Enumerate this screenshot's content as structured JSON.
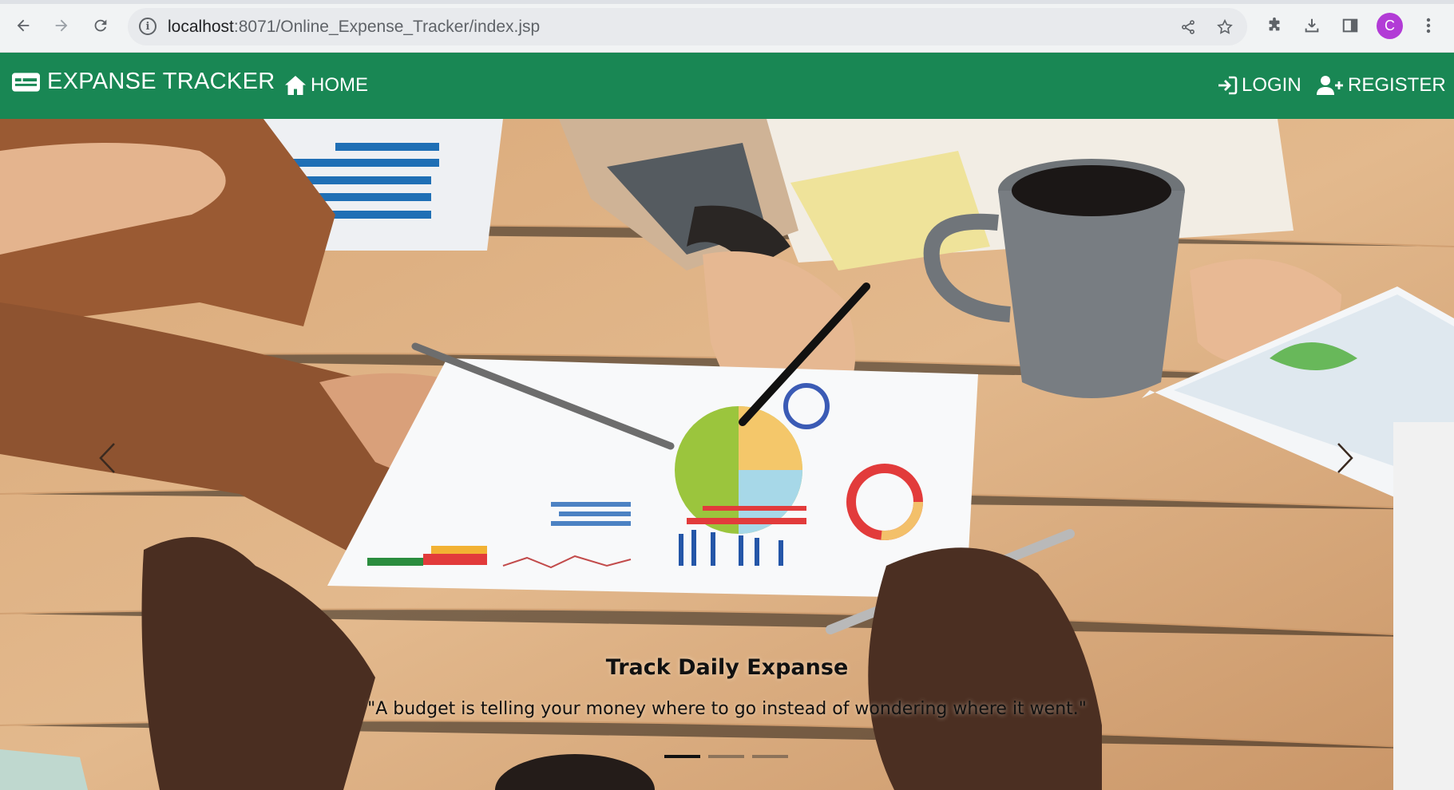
{
  "browser": {
    "url_host": "localhost",
    "url_rest": ":8071/Online_Expense_Tracker/index.jsp",
    "profile_initial": "C",
    "profile_color": "#b23bd6"
  },
  "navbar": {
    "brand": "EXPANSE TRACKER",
    "home": "HOME",
    "login": "LOGIN",
    "register": "REGISTER",
    "color": "#198754"
  },
  "carousel": {
    "caption_title": "Track Daily Expanse",
    "caption_text": "\"A budget is telling your money where to go instead of wondering where it went.\"",
    "slide_count": 3,
    "active_slide": 1
  }
}
